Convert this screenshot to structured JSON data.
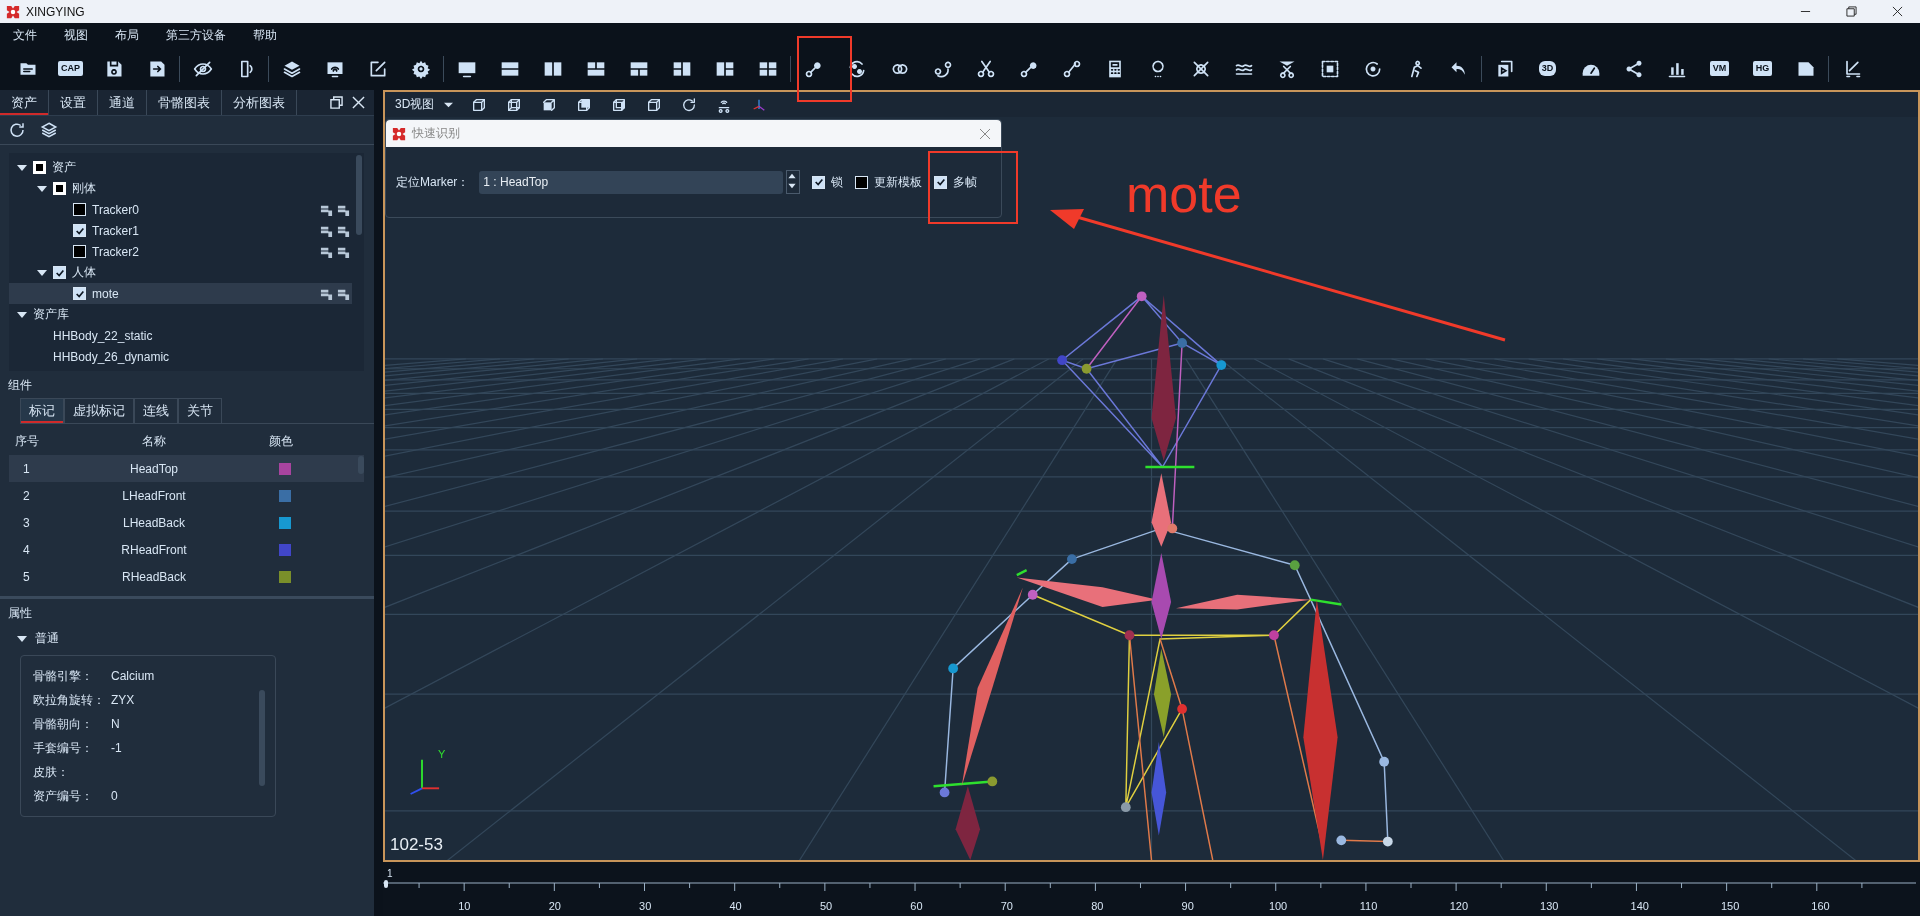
{
  "window": {
    "title": "XINGYING"
  },
  "menu": [
    "文件",
    "视图",
    "布局",
    "第三方设备",
    "帮助"
  ],
  "toolbar": {
    "icon_texts": [
      "CAP",
      "3D",
      "VM",
      "HG"
    ]
  },
  "left_tabs": [
    {
      "label": "资产",
      "selected": true
    },
    {
      "label": "设置",
      "selected": false
    },
    {
      "label": "通道",
      "selected": false
    },
    {
      "label": "骨骼图表",
      "selected": false
    },
    {
      "label": "分析图表",
      "selected": false
    }
  ],
  "asset_tree": [
    {
      "label": "资产",
      "checked": false,
      "mixed": true,
      "expanded": true,
      "selected": false,
      "children": [
        {
          "label": "刚体",
          "checked": false,
          "mixed": true,
          "expanded": true,
          "selected": false,
          "children": [
            {
              "label": "Tracker0",
              "checked": false,
              "selected": false
            },
            {
              "label": "Tracker1",
              "checked": true,
              "selected": false
            },
            {
              "label": "Tracker2",
              "checked": false,
              "selected": false
            }
          ]
        },
        {
          "label": "人体",
          "checked": true,
          "expanded": true,
          "selected": false,
          "children": [
            {
              "label": "mote",
              "checked": true,
              "selected": true
            }
          ]
        }
      ]
    },
    {
      "label": "资产库",
      "expanded": true,
      "selected": false,
      "children": [
        {
          "label": "HHBody_22_static",
          "selected": false
        },
        {
          "label": "HHBody_26_dynamic",
          "selected": false
        }
      ]
    }
  ],
  "components": {
    "title": "组件",
    "tabs": [
      {
        "label": "标记",
        "selected": true
      },
      {
        "label": "虚拟标记",
        "selected": false
      },
      {
        "label": "连线",
        "selected": false
      },
      {
        "label": "关节",
        "selected": false
      }
    ],
    "columns": [
      "序号",
      "名称",
      "颜色"
    ],
    "rows": [
      {
        "index": "1",
        "name": "HeadTop",
        "color": "#a8449f",
        "selected": true
      },
      {
        "index": "2",
        "name": "LHeadFront",
        "color": "#3a6ea5",
        "selected": false
      },
      {
        "index": "3",
        "name": "LHeadBack",
        "color": "#1798d0",
        "selected": false
      },
      {
        "index": "4",
        "name": "RHeadFront",
        "color": "#4146c8",
        "selected": false
      },
      {
        "index": "5",
        "name": "RHeadBack",
        "color": "#7a8f2a",
        "selected": false
      }
    ]
  },
  "properties": {
    "title": "属性",
    "section": {
      "label": "普通",
      "expanded": true,
      "rows": [
        {
          "label": "骨骼引擎：",
          "value": "Calcium"
        },
        {
          "label": "欧拉角旋转：",
          "value": "ZYX"
        },
        {
          "label": "骨骼朝向：",
          "value": "N"
        },
        {
          "label": "手套编号：",
          "value": "-1"
        },
        {
          "label": "皮肤："
        },
        {
          "label": "资产编号：",
          "value": "0"
        }
      ]
    }
  },
  "viewport": {
    "view_menu": "3D视图",
    "caption": "102-53",
    "axis_label": "Y"
  },
  "dialog": {
    "title": "快速识别",
    "field_label": "定位Marker：",
    "field_value": "1 : HeadTop",
    "options": [
      {
        "label": "锁",
        "checked": true
      },
      {
        "label": "更新模板",
        "checked": false
      },
      {
        "label": "多帧",
        "checked": true
      }
    ]
  },
  "annotation": {
    "text": "mote"
  },
  "timeline": {
    "current_frame": "1",
    "labels": [
      "10",
      "20",
      "30",
      "40",
      "50",
      "60",
      "70",
      "80",
      "90",
      "100",
      "110",
      "120",
      "130",
      "140",
      "150",
      "160"
    ]
  }
}
